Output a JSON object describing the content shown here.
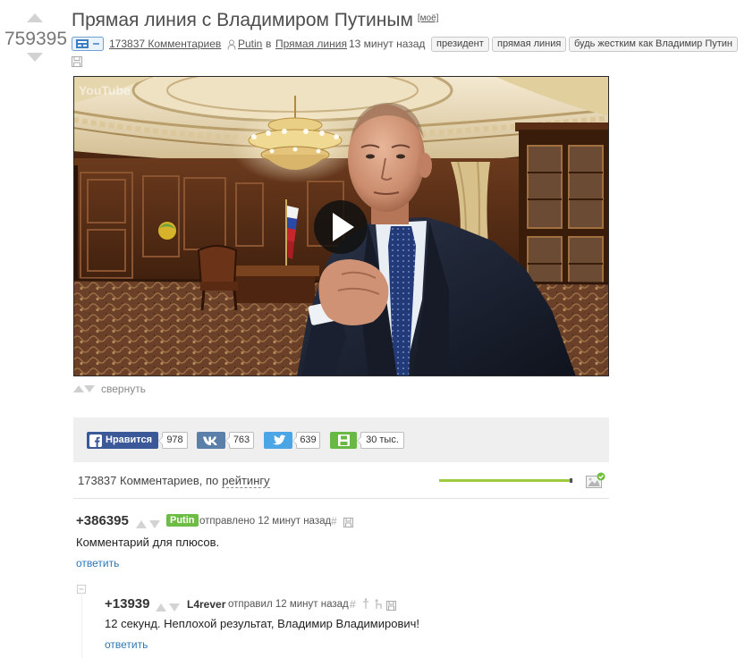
{
  "post": {
    "rating": "759395",
    "title": "Прямая линия с Владимиром Путиным",
    "mine_label": "[моё]",
    "comments_link": "173837 Комментариев",
    "author": "Putin",
    "in_word": "в",
    "community": "Прямая линия",
    "time": "13 минут назад",
    "tags": [
      "президент",
      "прямая линия",
      "будь жестким как Владимир Путин"
    ],
    "video": {
      "watermark": "YouTube"
    },
    "collapse_label": "свернуть"
  },
  "share": {
    "facebook": {
      "label": "Нравится",
      "count": "978"
    },
    "vk": {
      "count": "763"
    },
    "twitter": {
      "count": "639"
    },
    "save": {
      "count": "30 тыс."
    }
  },
  "comments_header": {
    "count_text": "173837 Комментариев, по",
    "sort_label": "рейтингу",
    "rating_filter_level": 0.98
  },
  "comments": [
    {
      "rating": "+386395",
      "author": "Putin",
      "author_is_post_author": true,
      "meta": "отправлено 12 минут назад",
      "hash": "#",
      "text": "Комментарий для плюсов.",
      "reply": "ответить"
    },
    {
      "rating": "+13939",
      "author": "L4rever",
      "meta": "отправил 12 минут назад",
      "hash": "#",
      "text": "12 секунд. Неплохой результат, Владимир Владимирович!",
      "reply": "ответить"
    }
  ],
  "icons": {
    "vote_up": "upvote-arrow-icon",
    "vote_down": "downvote-arrow-icon",
    "post_type": "post-type-icon",
    "user": "user-icon",
    "save": "save-icon",
    "play": "play-icon",
    "facebook": "facebook-icon",
    "vk": "vk-icon",
    "twitter": "twitter-icon",
    "image_toggle": "image-check-icon",
    "collapse_thread": "collapse-thread-icon",
    "pin": "pin-icon",
    "chair": "chair-icon"
  },
  "colors": {
    "facebook": "#3b5998",
    "vk": "#5a7fa8",
    "twitter": "#4ca6e6",
    "save": "#67b944",
    "author_badge": "#6dbd45",
    "rating_filter": "#9ccb3b",
    "reply_link": "#2b77b8"
  }
}
